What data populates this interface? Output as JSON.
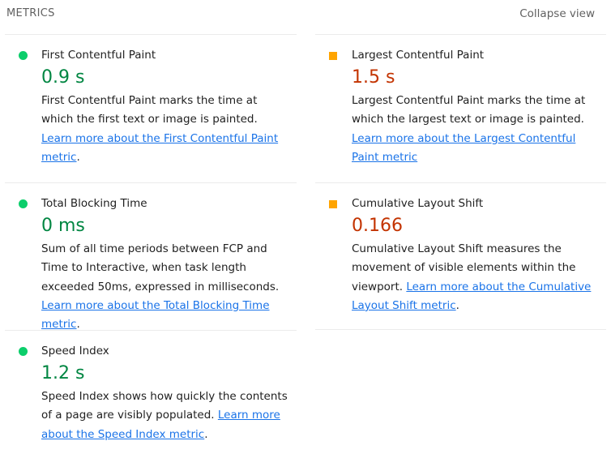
{
  "header": {
    "title": "METRICS",
    "collapse_label": "Collapse view"
  },
  "metrics": [
    {
      "title": "First Contentful Paint",
      "value": "0.9 s",
      "status": "pass",
      "description": "First Contentful Paint marks the time at which the first text or image is painted. ",
      "link": "Learn more about the First Contentful Paint metric",
      "suffix": "."
    },
    {
      "title": "Largest Contentful Paint",
      "value": "1.5 s",
      "status": "average",
      "description": "Largest Contentful Paint marks the time at which the largest text or image is painted. ",
      "link": "Learn more about the Largest Contentful Paint metric",
      "suffix": ""
    },
    {
      "title": "Total Blocking Time",
      "value": "0 ms",
      "status": "pass",
      "description": "Sum of all time periods between FCP and Time to Interactive, when task length exceeded 50ms, expressed in milliseconds. ",
      "link": "Learn more about the Total Blocking Time metric",
      "suffix": "."
    },
    {
      "title": "Cumulative Layout Shift",
      "value": "0.166",
      "status": "average",
      "description": "Cumulative Layout Shift measures the movement of visible elements within the viewport. ",
      "link": "Learn more about the Cumulative Layout Shift metric",
      "suffix": "."
    },
    {
      "title": "Speed Index",
      "value": "1.2 s",
      "status": "pass",
      "description": "Speed Index shows how quickly the contents of a page are visibly populated. ",
      "link": "Learn more about the Speed Index metric",
      "suffix": "."
    }
  ],
  "colors": {
    "pass_indicator": "#0cce6b",
    "pass_text": "#018642",
    "average_indicator": "#ffa400",
    "average_text": "#c33300",
    "link": "#1a73e8"
  }
}
